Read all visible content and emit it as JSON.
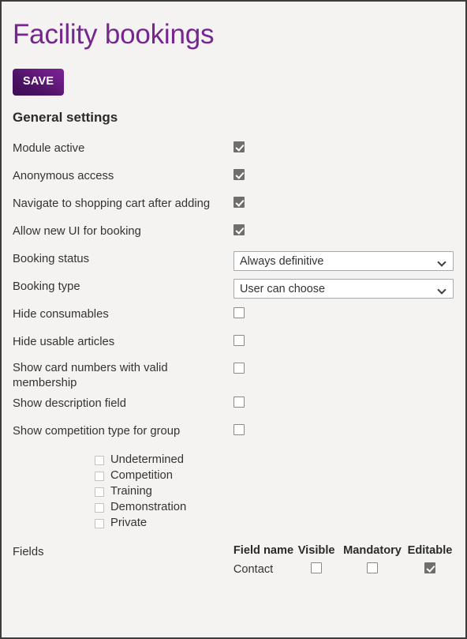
{
  "page": {
    "title": "Facility bookings",
    "background_color": "#f4f3f1",
    "accent_color": "#76268f",
    "border_color": "#3c3c3c"
  },
  "toolbar": {
    "save_label": "SAVE"
  },
  "general_settings": {
    "heading": "General settings",
    "rows": [
      {
        "label": "Module active",
        "control": "checkbox",
        "checked": true
      },
      {
        "label": "Anonymous access",
        "control": "checkbox",
        "checked": true
      },
      {
        "label": "Navigate to shopping cart after adding",
        "control": "checkbox",
        "checked": true
      },
      {
        "label": "Allow new UI for booking",
        "control": "checkbox",
        "checked": true
      },
      {
        "label": "Booking status",
        "control": "select",
        "value": "Always definitive"
      },
      {
        "label": "Booking type",
        "control": "select",
        "value": "User can choose"
      },
      {
        "label": "Hide consumables",
        "control": "checkbox",
        "checked": false
      },
      {
        "label": "Hide usable articles",
        "control": "checkbox",
        "checked": false
      },
      {
        "label": "Show card numbers with valid membership",
        "control": "checkbox",
        "checked": false
      },
      {
        "label": "Show description field",
        "control": "checkbox",
        "checked": false
      },
      {
        "label": "Show competition type for group",
        "control": "checkbox",
        "checked": false
      }
    ]
  },
  "competition_types": [
    {
      "label": "Undetermined",
      "checked": false
    },
    {
      "label": "Competition",
      "checked": false
    },
    {
      "label": "Training",
      "checked": false
    },
    {
      "label": "Demonstration",
      "checked": false
    },
    {
      "label": "Private",
      "checked": false
    }
  ],
  "fields": {
    "label": "Fields",
    "columns": [
      "Field name",
      "Visible",
      "Mandatory",
      "Editable"
    ],
    "rows": [
      {
        "name": "Contact",
        "visible": false,
        "mandatory": false,
        "editable": true
      }
    ]
  },
  "icons": {
    "chevron_down": "chevron-down-icon",
    "checkmark": "check-icon"
  }
}
